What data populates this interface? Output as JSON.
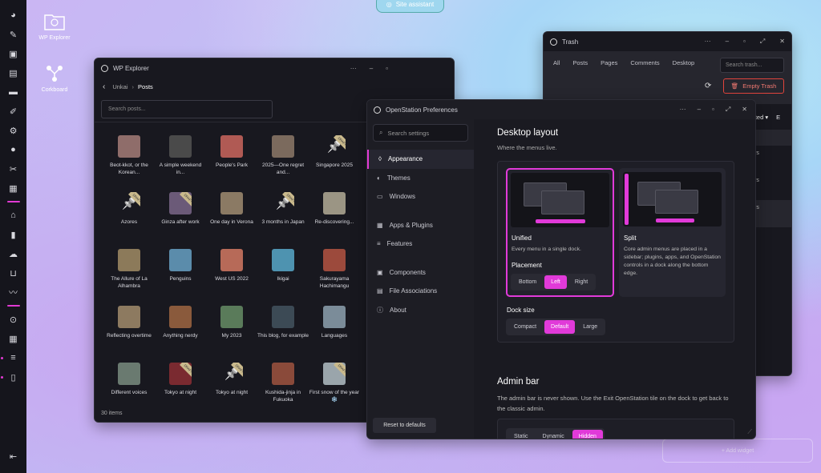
{
  "colors": {
    "accent": "#e13ad9",
    "window_bg": "#18181f"
  },
  "assistant": {
    "label": "Site assistant"
  },
  "dock_icons": [
    "dashboard-icon",
    "pin-icon",
    "media-icon",
    "pages-icon",
    "comments-icon",
    "brush-icon",
    "plugins-icon",
    "user-icon",
    "tools-icon",
    "settings-icon",
    "home-icon",
    "stats-icon",
    "cloud-icon",
    "cart-icon",
    "activity-icon",
    "feedback-icon",
    "apps-icon",
    "sliders-icon",
    "trash-icon",
    "logout-icon"
  ],
  "desktop": {
    "wp_explorer": "WP Explorer",
    "corkboard": "Corkboard",
    "add_widget": "+ Add widget"
  },
  "explorer": {
    "title": "WP Explorer",
    "crumb_root": "Unkai",
    "crumb_current": "Posts",
    "search_placeholder": "Search posts...",
    "count": "30 items",
    "posts": [
      {
        "title": "Beot-kkot, or the Korean...",
        "draft": false,
        "color": "#8f6d6a"
      },
      {
        "title": "A simple weekend in...",
        "draft": false,
        "color": "#4a4a4a"
      },
      {
        "title": "People's Park",
        "draft": false,
        "color": "#b05a54"
      },
      {
        "title": "2025—One regret and...",
        "draft": false,
        "color": "#7b6a5d"
      },
      {
        "title": "Singapore 2025",
        "draft": true,
        "color": ""
      },
      {
        "title": "Azores",
        "draft": true,
        "color": ""
      },
      {
        "title": "Ginza after work",
        "draft": true,
        "color": "#6b5a78"
      },
      {
        "title": "One day in Verona",
        "draft": false,
        "color": "#8b7a64"
      },
      {
        "title": "3 months in Japan",
        "draft": true,
        "color": ""
      },
      {
        "title": "Re-discovering...",
        "draft": false,
        "color": "#9b9584"
      },
      {
        "title": "The Allure of La Alhambra",
        "draft": false,
        "color": "#8c7a5a"
      },
      {
        "title": "Penguins",
        "draft": false,
        "color": "#5b8cab"
      },
      {
        "title": "West US 2022",
        "draft": false,
        "color": "#b76a58"
      },
      {
        "title": "Ikigai",
        "draft": false,
        "color": "#4e93b0"
      },
      {
        "title": "Sakurayama Hachimangu",
        "draft": false,
        "color": "#9c4a3c"
      },
      {
        "title": "Reflecting overtime",
        "draft": false,
        "color": "#8d7a60"
      },
      {
        "title": "Anything nerdy",
        "draft": false,
        "color": "#8a5a3c"
      },
      {
        "title": "My 2023",
        "draft": false,
        "color": "#5a7b5a"
      },
      {
        "title": "This blog, for example",
        "draft": false,
        "color": "#3c4a55"
      },
      {
        "title": "Languages",
        "draft": false,
        "color": "#7b8c99"
      },
      {
        "title": "Different voices",
        "draft": false,
        "color": "#6a7a70"
      },
      {
        "title": "Tokyo at night",
        "draft": true,
        "color": "#7a2a30"
      },
      {
        "title": "Tokyo at night",
        "draft": true,
        "color": ""
      },
      {
        "title": "Kushida-jinja in Fukuoka",
        "draft": false,
        "color": "#8a4a3a"
      },
      {
        "title": "First snow of the year ❄️",
        "draft": true,
        "color": "#9aa5ab"
      }
    ]
  },
  "trash": {
    "title": "Trash",
    "tabs": [
      "All",
      "Posts",
      "Pages",
      "Comments",
      "Desktop"
    ],
    "search_placeholder": "Search trash...",
    "empty_label": "Empty Trash",
    "col_header": "leted ▾",
    "col_header2": "E",
    "rows": [
      "ays",
      "ays",
      "ays"
    ],
    "row_sub": "0"
  },
  "prefs": {
    "title": "OpenStation Preferences",
    "search_placeholder": "Search settings",
    "nav": [
      {
        "label": "Appearance",
        "icon": "drop-icon",
        "active": true
      },
      {
        "label": "Themes",
        "icon": "contrast-icon",
        "active": false
      },
      {
        "label": "Windows",
        "icon": "windows-icon",
        "active": false
      },
      {
        "label": "Apps & Plugins",
        "icon": "grid-icon",
        "active": false
      },
      {
        "label": "Features",
        "icon": "sliders-icon",
        "active": false
      },
      {
        "label": "Components",
        "icon": "components-icon",
        "active": false
      },
      {
        "label": "File Associations",
        "icon": "file-icon",
        "active": false
      },
      {
        "label": "About",
        "icon": "info-icon",
        "active": false
      }
    ],
    "reset_label": "Reset to defaults",
    "layout": {
      "heading": "Desktop layout",
      "sub": "Where the menus live.",
      "unified": {
        "name": "Unified",
        "desc": "Every menu in a single dock."
      },
      "split": {
        "name": "Split",
        "desc": "Core admin menus are placed in a sidebar; plugins, apps, and OpenStation controls in a dock along the bottom edge."
      },
      "placement_label": "Placement",
      "placement": [
        "Bottom",
        "Left",
        "Right"
      ],
      "placement_selected": "Left",
      "dock_size_label": "Dock size",
      "dock_size": [
        "Compact",
        "Default",
        "Large"
      ],
      "dock_size_selected": "Default"
    },
    "admin_bar": {
      "heading": "Admin bar",
      "desc": "The admin bar is never shown. Use the Exit OpenStation tile on the dock to get back to the classic admin.",
      "options": [
        "Static",
        "Dynamic",
        "Hidden"
      ],
      "selected": "Hidden"
    }
  }
}
